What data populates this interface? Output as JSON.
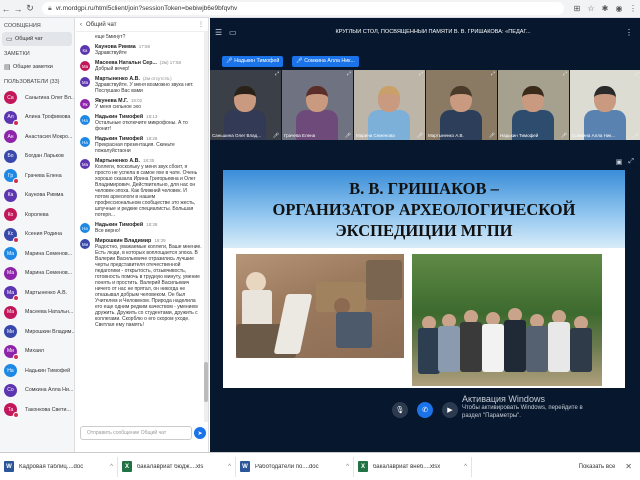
{
  "browser": {
    "url": "vr.mordgpi.ru/html5client/join?sessionToken=bebiwjb6e9bfqvhv"
  },
  "left_nav": {
    "messages_header": "СООБЩЕНИЯ",
    "chat_item": "Общий чат",
    "notes_header": "ЗАМЕТКИ",
    "notes_item": "Общие заметки",
    "users_header": "ПОЛЬЗОВАТЕЛИ (33)",
    "users": [
      {
        "initials": "Са",
        "name": "Саныгина Олег Вл...",
        "color": "#c2185b"
      },
      {
        "initials": "Ал",
        "name": "Алина Трофимова",
        "color": "#5e35b1"
      },
      {
        "initials": "Ан",
        "name": "Анастасия Мокро...",
        "color": "#8e24aa"
      },
      {
        "initials": "Бо",
        "name": "Богдан Ларьков",
        "color": "#3949ab"
      },
      {
        "initials": "Гр",
        "name": "Грачева Елена",
        "color": "#1e88e5"
      },
      {
        "initials": "Ка",
        "name": "Каунова Римма",
        "color": "#5e35b1"
      },
      {
        "initials": "Ко",
        "name": "Королева",
        "color": "#c2185b"
      },
      {
        "initials": "Кс",
        "name": "Ксения Родина",
        "color": "#3949ab"
      },
      {
        "initials": "Ма",
        "name": "Марина Семенов...",
        "color": "#1e88e5"
      },
      {
        "initials": "Ма",
        "name": "Марина Семенов...",
        "color": "#8e24aa"
      },
      {
        "initials": "Ма",
        "name": "Мартыненко А.В.",
        "color": "#5e35b1"
      },
      {
        "initials": "Ма",
        "name": "Масеева Натальн...",
        "color": "#c2185b"
      },
      {
        "initials": "Ми",
        "name": "Мирошкин Владим...",
        "color": "#3949ab"
      },
      {
        "initials": "Ми",
        "name": "Михаил",
        "color": "#8e24aa"
      },
      {
        "initials": "На",
        "name": "Надькин Тимофей",
        "color": "#1e88e5"
      },
      {
        "initials": "Со",
        "name": "Сомкина Алла Ни...",
        "color": "#5e35b1"
      },
      {
        "initials": "Та",
        "name": "Таконкова Свети...",
        "color": "#c2185b"
      }
    ]
  },
  "chat": {
    "title": "Общий чат",
    "input_placeholder": "Отправить сообщение Общий чат",
    "messages": [
      {
        "initials": "",
        "name": "",
        "time": "",
        "text": "еще 5минут?",
        "color": "#fff"
      },
      {
        "initials": "Ка",
        "name": "Каунова Римма",
        "time": "17:58",
        "text": "Здравствуйте",
        "color": "#5e35b1"
      },
      {
        "initials": "Ма",
        "name": "Масеева Натальн Сер...",
        "time": "(2м) 17:58",
        "text": "Добрый вечер!",
        "color": "#c2185b"
      },
      {
        "initials": "Ма",
        "name": "Мартыненко А.В.",
        "time": "(2м отсутств.)",
        "text": "Здравствуйте. У меня возможно звука нет. Послушаю Вас вами",
        "color": "#5e35b1"
      },
      {
        "initials": "Як",
        "name": "Якунева М.Г.",
        "time": "18:02",
        "text": "У меня сильное эхо",
        "color": "#8e24aa"
      },
      {
        "initials": "На",
        "name": "Надькин Тимофей",
        "time": "18:13",
        "text": "Остальные отключите микрофоны. А то фонит!",
        "color": "#1e88e5"
      },
      {
        "initials": "На",
        "name": "Надькин Тимофей",
        "time": "18:28",
        "text": "Прекрасная презентация. Скиньте пожалуйстаони",
        "color": "#1e88e5"
      },
      {
        "initials": "Ма",
        "name": "Мартыненко А.В.",
        "time": "18:35",
        "text": "Коллеги, поскольку у меня звук сбоит, я просто не успела в самое яхе в чате. Очень хорошо сказала Ирина Григорьевна и Олег Владимирович. Действительно, для нас он человек-эпоха. Как ближний человек. И потом археологи в нашем профессиональном сообществе это жесть, шпучные и редкие специалисты. Большая потеря...",
        "color": "#5e35b1"
      },
      {
        "initials": "На",
        "name": "Надькин Тимофей",
        "time": "18:38",
        "text": "Все верно!",
        "color": "#1e88e5"
      },
      {
        "initials": "Ми",
        "name": "Мирошкин Владимир",
        "time": "18:39",
        "text": "Радостно, уважаемые коллеги, Ваше мнение. Есть люди, в которых воплощается эпоха. В Валерии Васильевиче отразились лучшие черты представителя отечественной педагогики - открытость, отзывчивость, готовность помочь в трудную минуту, умение понять и простить. Валерий Васильевич ничего от нас не прятал, он никогда не отказывал добрым человеком. Он был Учителем и Человеком. Природа наделила его еще одним редким качеством - умением дружить. Дружить со студентами, дружить с коллегами. Скорблю о его скором уходе. Светлая ему память!",
        "color": "#3949ab"
      }
    ]
  },
  "conference": {
    "title": "КРУГЛЫЙ СТОЛ, ПОСВЯЩЕННЫЙ ПАМЯТИ В. В. ГРИШАКОВА: «ПЕДАГ...",
    "speakers": [
      "Надькин Тимофей",
      "Сомкина Алла Ник..."
    ],
    "tiles": [
      {
        "label": "Саньшина Олег Влад...",
        "hair": "#2a2218",
        "shirt": "#333a55",
        "bg": "#3b3f47"
      },
      {
        "label": "Грачева Елена",
        "hair": "#5a2f2a",
        "shirt": "#6d4a7a",
        "bg": "#6f7280"
      },
      {
        "label": "Марина Семенова",
        "hair": "#c9a06a",
        "shirt": "#7db0d8",
        "bg": "#bdb5a8"
      },
      {
        "label": "Мартыненко А.В.",
        "hair": "#4a3a2a",
        "shirt": "#2d3e5a",
        "bg": "#8a7a64"
      },
      {
        "label": "Надькин Тимофей",
        "hair": "#3a2a1a",
        "shirt": "#2e4c6e",
        "bg": "#a6a08f"
      },
      {
        "label": "Сомкина Алла Ник...",
        "hair": "#2a2a2a",
        "shirt": "#5a82b0",
        "bg": "#dcdcd2"
      }
    ],
    "slide_title": "В. В. ГРИШАКОВ –\nОРГАНИЗАТОР АРХЕОЛОГИЧЕСКОЙ\nЭКСПЕДИЦИИ МГПИ"
  },
  "watermark": {
    "line1": "Активация Windows",
    "line2": "Чтобы активировать Windows, перейдите в",
    "line3": "раздел \"Параметры\"."
  },
  "taskbar": {
    "downloads": [
      {
        "name": "Кадровая таблиц....doc",
        "type": "W",
        "color": "#2b579a"
      },
      {
        "name": "бакалавриат бюдж....xls",
        "type": "X",
        "color": "#217346"
      },
      {
        "name": "Работодатели по....doc",
        "type": "W",
        "color": "#2b579a"
      },
      {
        "name": "бакалавриат внеб....xlsx",
        "type": "X",
        "color": "#217346"
      }
    ],
    "show_all": "Показать все"
  }
}
